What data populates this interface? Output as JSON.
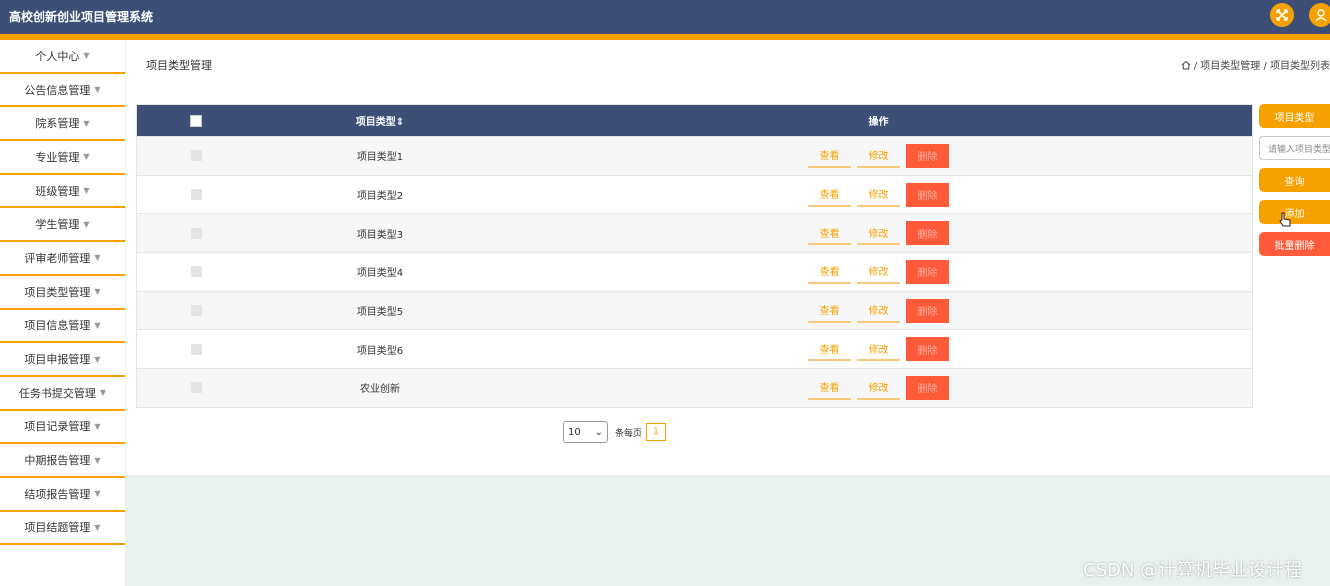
{
  "app": {
    "title": "高校创新创业项目管理系统"
  },
  "icons": {
    "fullscreen": "fullscreen-icon",
    "user": "user-icon",
    "home": "home-icon",
    "caret": "caret-down-icon",
    "cursor": "hand-cursor-icon"
  },
  "colors": {
    "header": "#3d4f76",
    "accent": "#f7a100",
    "danger": "#ff5a3a"
  },
  "sidebar": {
    "items": [
      {
        "label": "个人中心"
      },
      {
        "label": "公告信息管理"
      },
      {
        "label": "院系管理"
      },
      {
        "label": "专业管理"
      },
      {
        "label": "班级管理"
      },
      {
        "label": "学生管理"
      },
      {
        "label": "评审老师管理"
      },
      {
        "label": "项目类型管理"
      },
      {
        "label": "项目信息管理"
      },
      {
        "label": "项目申报管理"
      },
      {
        "label": "任务书提交管理"
      },
      {
        "label": "项目记录管理"
      },
      {
        "label": "中期报告管理"
      },
      {
        "label": "结项报告管理"
      },
      {
        "label": "项目结题管理"
      }
    ]
  },
  "page": {
    "title": "项目类型管理",
    "breadcrumb": {
      "sep": "/",
      "level1": "项目类型管理",
      "level2": "项目类型列表"
    }
  },
  "table": {
    "headers": {
      "name": "项目类型",
      "sort_icon": "⇕",
      "ops": "操作"
    },
    "actions": {
      "view": "查看",
      "edit": "修改",
      "delete": "删除"
    },
    "rows": [
      {
        "name": "项目类型1"
      },
      {
        "name": "项目类型2"
      },
      {
        "name": "项目类型3"
      },
      {
        "name": "项目类型4"
      },
      {
        "name": "项目类型5"
      },
      {
        "name": "项目类型6"
      },
      {
        "name": "农业创新"
      }
    ]
  },
  "pagination": {
    "page_size": "10",
    "per_page_label": "条每页",
    "current_page": "1"
  },
  "search": {
    "label": "项目类型",
    "placeholder": "请输入项目类型",
    "query_button": "查询",
    "add_button": "添加",
    "bulk_delete_button": "批量删除"
  },
  "watermark": "CSDN @计算机毕业设计程"
}
